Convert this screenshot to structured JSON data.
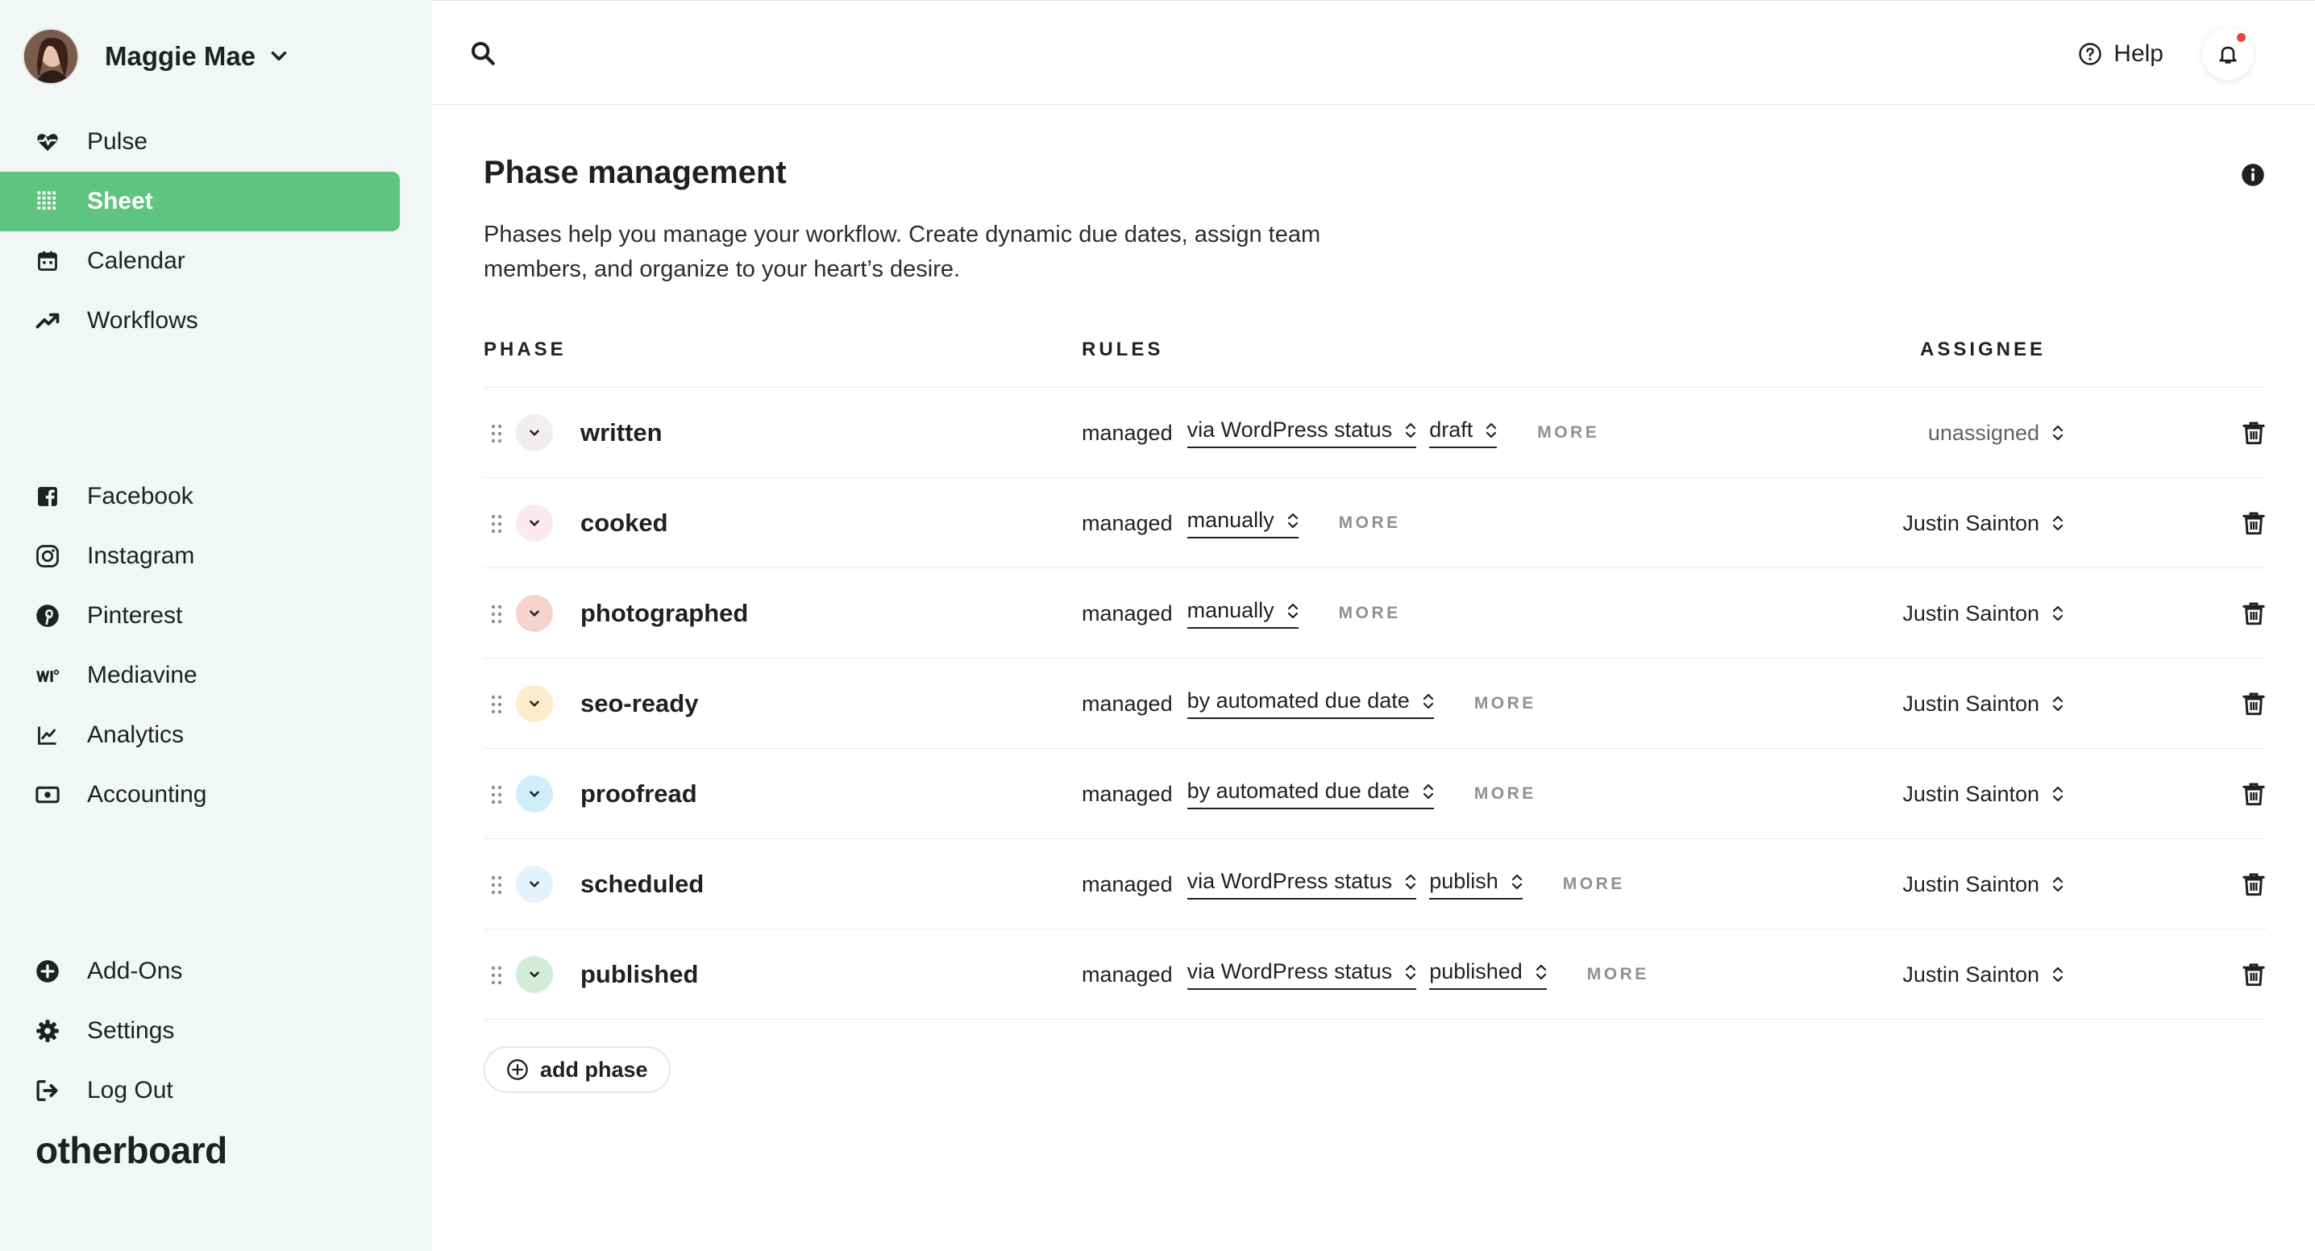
{
  "user": {
    "name": "Maggie Mae"
  },
  "nav": {
    "main": [
      {
        "label": "Pulse",
        "icon": "heart-pulse-icon",
        "active": false
      },
      {
        "label": "Sheet",
        "icon": "grid-icon",
        "active": true
      },
      {
        "label": "Calendar",
        "icon": "calendar-icon",
        "active": false
      },
      {
        "label": "Workflows",
        "icon": "trend-icon",
        "active": false
      }
    ],
    "social": [
      {
        "label": "Facebook",
        "icon": "facebook-icon"
      },
      {
        "label": "Instagram",
        "icon": "instagram-icon"
      },
      {
        "label": "Pinterest",
        "icon": "pinterest-icon"
      },
      {
        "label": "Mediavine",
        "icon": "mediavine-icon"
      },
      {
        "label": "Analytics",
        "icon": "chart-icon"
      },
      {
        "label": "Accounting",
        "icon": "money-icon"
      }
    ],
    "bottom": [
      {
        "label": "Add-Ons",
        "icon": "plus-circle-icon"
      },
      {
        "label": "Settings",
        "icon": "gear-icon"
      },
      {
        "label": "Log Out",
        "icon": "logout-icon"
      }
    ]
  },
  "brand": "otherboard",
  "topbar": {
    "help_label": "Help"
  },
  "page": {
    "title": "Phase management",
    "description": "Phases help you manage your workflow. Create dynamic due dates, assign team members, and organize to your heart’s desire.",
    "columns": {
      "phase": "PHASE",
      "rules": "RULES",
      "assignee": "ASSIGNEE"
    },
    "managed_label": "managed",
    "more_label": "MORE",
    "add_phase_label": "add phase"
  },
  "colors": {
    "accent": "#5ec47f",
    "sidebar_bg": "#f2f7f5",
    "notification_dot": "#e5463b"
  },
  "phases": [
    {
      "name": "written",
      "circle_bg": "#f3eeee",
      "rules": [
        "via WordPress status",
        "draft"
      ],
      "assignee": "unassigned"
    },
    {
      "name": "cooked",
      "circle_bg": "#fbe9ee",
      "rules": [
        "manually"
      ],
      "assignee": "Justin Sainton"
    },
    {
      "name": "photographed",
      "circle_bg": "#f6d3cc",
      "rules": [
        "manually"
      ],
      "assignee": "Justin Sainton"
    },
    {
      "name": "seo-ready",
      "circle_bg": "#fdeccb",
      "rules": [
        "by automated due date"
      ],
      "assignee": "Justin Sainton"
    },
    {
      "name": "proofread",
      "circle_bg": "#cfeef8",
      "rules": [
        "by automated due date"
      ],
      "assignee": "Justin Sainton"
    },
    {
      "name": "scheduled",
      "circle_bg": "#e3f3fb",
      "rules": [
        "via WordPress status",
        "publish"
      ],
      "assignee": "Justin Sainton"
    },
    {
      "name": "published",
      "circle_bg": "#d3ecd9",
      "rules": [
        "via WordPress status",
        "published"
      ],
      "assignee": "Justin Sainton"
    }
  ]
}
